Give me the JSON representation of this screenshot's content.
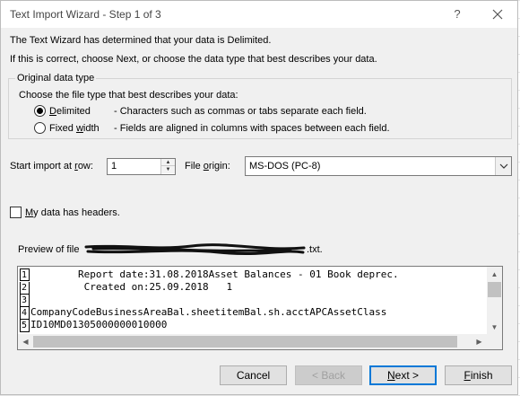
{
  "window": {
    "title": "Text Import Wizard - Step 1 of 3",
    "help_label": "?"
  },
  "intro": {
    "line1": "The Text Wizard has determined that your data is Delimited.",
    "line2": "If this is correct, choose Next, or choose the data type that best describes your data."
  },
  "original_data_type": {
    "group_label": "Original data type",
    "prompt": "Choose the file type that best describes your data:",
    "options": [
      {
        "mnemonic": "D",
        "rest": "elimited",
        "description": "- Characters such as commas or tabs separate each field.",
        "selected": true
      },
      {
        "before": "Fixed ",
        "mnemonic": "w",
        "rest": "idth",
        "description": "- Fields are aligned in columns with spaces between each field.",
        "selected": false
      }
    ]
  },
  "start_import": {
    "label_before": "Start import at ",
    "label_mnemonic": "r",
    "label_after": "ow:",
    "value": "1"
  },
  "file_origin": {
    "label_before": "File ",
    "label_mnemonic": "o",
    "label_after": "rigin:",
    "value": "MS-DOS (PC-8)"
  },
  "headers_checkbox": {
    "mnemonic": "M",
    "rest": "y data has headers.",
    "checked": false
  },
  "preview": {
    "label_prefix": "Preview of file",
    "label_suffix": ".txt.",
    "lines": [
      {
        "number": "1",
        "text": "        Report date:31.08.2018Asset Balances - 01 Book deprec."
      },
      {
        "number": "2",
        "text": "         Created on:25.09.2018   1"
      },
      {
        "number": "3",
        "text": ""
      },
      {
        "number": "4",
        "text": "CompanyCodeBusinessAreaBal.sheetitemBal.sh.acctAPCAssetClass"
      },
      {
        "number": "5",
        "text": "ID10MD01305000000010000"
      }
    ]
  },
  "buttons": {
    "cancel": "Cancel",
    "back": "< Back",
    "next_mnemonic": "N",
    "next_rest": "ext >",
    "finish_mnemonic": "F",
    "finish_rest": "inish"
  }
}
